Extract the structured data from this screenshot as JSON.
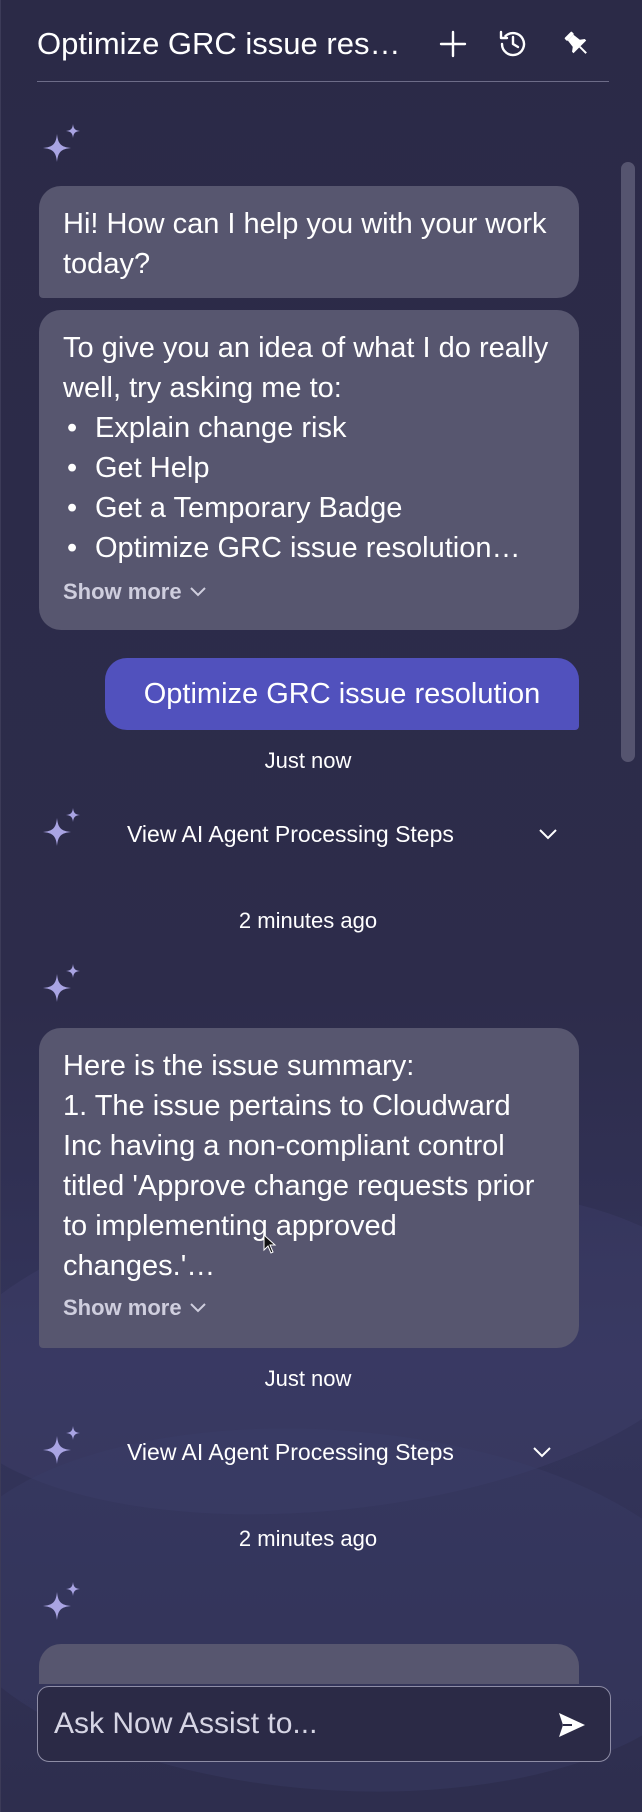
{
  "header": {
    "title": "Optimize GRC issue res…",
    "new_icon": "plus-icon",
    "history_icon": "history-icon",
    "pin_icon": "pin-icon"
  },
  "colors": {
    "panel_bg": "#2b2a47",
    "bubble_bg": "#57566f",
    "user_bubble_bg": "#5151bd",
    "sparkle": "#a9a4e3"
  },
  "messages": {
    "greeting": "Hi! How can I help you with your work today?",
    "intro": "To give you an idea of what I do really well, try asking me to:",
    "suggestions": [
      "Explain change risk",
      "Get Help",
      "Get a Temporary Badge",
      "Optimize GRC issue resolution…"
    ],
    "show_more_1": "Show more",
    "user_message": "Optimize GRC issue resolution",
    "user_time": "Just now",
    "steps_label_1": "View AI Agent Processing Steps",
    "steps_time_1": "2 minutes ago",
    "summary_title": "Here is the issue summary:",
    "summary_body": "1. The issue pertains to Cloudward Inc having a non-compliant control titled 'Approve change requests prior to implementing approved changes.'…",
    "show_more_2": "Show more",
    "summary_time": "Just now",
    "steps_label_2": "View AI Agent Processing Steps",
    "steps_time_2": "2 minutes ago"
  },
  "input": {
    "placeholder": "Ask Now Assist to...",
    "value": "",
    "send_icon": "send-icon"
  }
}
